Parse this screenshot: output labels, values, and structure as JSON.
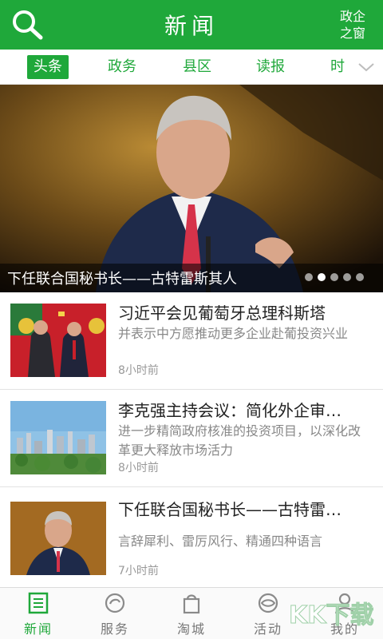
{
  "header": {
    "title": "新闻",
    "right_label_line1": "政企",
    "right_label_line2": "之窗",
    "accent": "#1fa83a"
  },
  "tabs": [
    {
      "label": "头条",
      "active": true
    },
    {
      "label": "政务",
      "active": false
    },
    {
      "label": "县区",
      "active": false
    },
    {
      "label": "读报",
      "active": false
    },
    {
      "label": "时",
      "active": false
    }
  ],
  "hero": {
    "caption": "下任联合国秘书长——古特雷斯其人",
    "slide_count": 5,
    "active_slide": 2
  },
  "news": [
    {
      "title": "习近平会见葡萄牙总理科斯塔",
      "summary": "并表示中方愿推动更多企业赴葡投资兴业",
      "time": "8小时前"
    },
    {
      "title": "李克强主持会议：简化外企审…",
      "summary": "进一步精简政府核准的投资项目，以深化改革更大释放市场活力",
      "time": "8小时前"
    },
    {
      "title": "下任联合国秘书长——古特雷…",
      "summary": "言辞犀利、雷厉风行、精通四种语言",
      "time": "7小时前"
    }
  ],
  "bottom_nav": [
    {
      "label": "新闻",
      "icon": "newspaper-icon",
      "active": true
    },
    {
      "label": "服务",
      "icon": "service-icon",
      "active": false
    },
    {
      "label": "淘城",
      "icon": "shopping-bag-icon",
      "active": false
    },
    {
      "label": "活动",
      "icon": "activity-icon",
      "active": false
    },
    {
      "label": "我的",
      "icon": "user-icon",
      "active": false
    }
  ],
  "watermark": "KK下载"
}
